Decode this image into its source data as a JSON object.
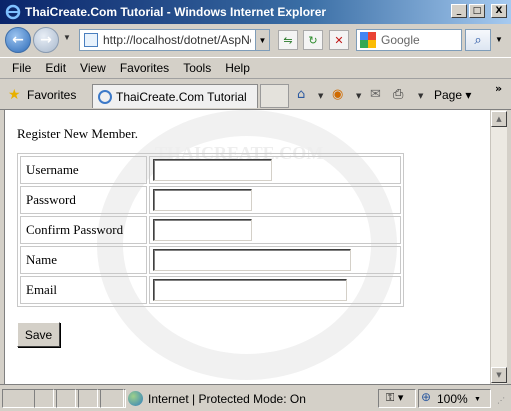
{
  "window": {
    "title": "ThaiCreate.Com Tutorial - Windows Internet Explorer",
    "minimize": "_",
    "maximize": "□",
    "close": "X"
  },
  "toolbar": {
    "back_glyph": "←",
    "forward_glyph": "→",
    "address": "http://localhost/dotnet/AspNet",
    "search_placeholder": "Google",
    "search_glyph": "⌕",
    "compat_glyph": "⇋",
    "refresh_glyph": "↻",
    "stop_glyph": "✕"
  },
  "menu": {
    "items": [
      "File",
      "Edit",
      "View",
      "Favorites",
      "Tools",
      "Help"
    ]
  },
  "favorites_bar": {
    "favorites_label": "Favorites",
    "tab_title": "ThaiCreate.Com Tutorial",
    "page_menu": "Page ▾",
    "overflow": "»"
  },
  "page": {
    "heading": "Register New Member.",
    "fields": [
      {
        "label": "Username",
        "value": ""
      },
      {
        "label": "Password",
        "value": ""
      },
      {
        "label": "Confirm Password",
        "value": ""
      },
      {
        "label": "Name",
        "value": ""
      },
      {
        "label": "Email",
        "value": ""
      }
    ],
    "save_label": "Save",
    "watermark": "THAICREATE.COM"
  },
  "status": {
    "zone": "Internet | Protected Mode: On",
    "zoom": "100%"
  },
  "colors": {
    "titlebar_start": "#0a246a",
    "titlebar_end": "#a6caf0",
    "chrome": "#d4d0c8",
    "content_bg": "#ffffff"
  }
}
